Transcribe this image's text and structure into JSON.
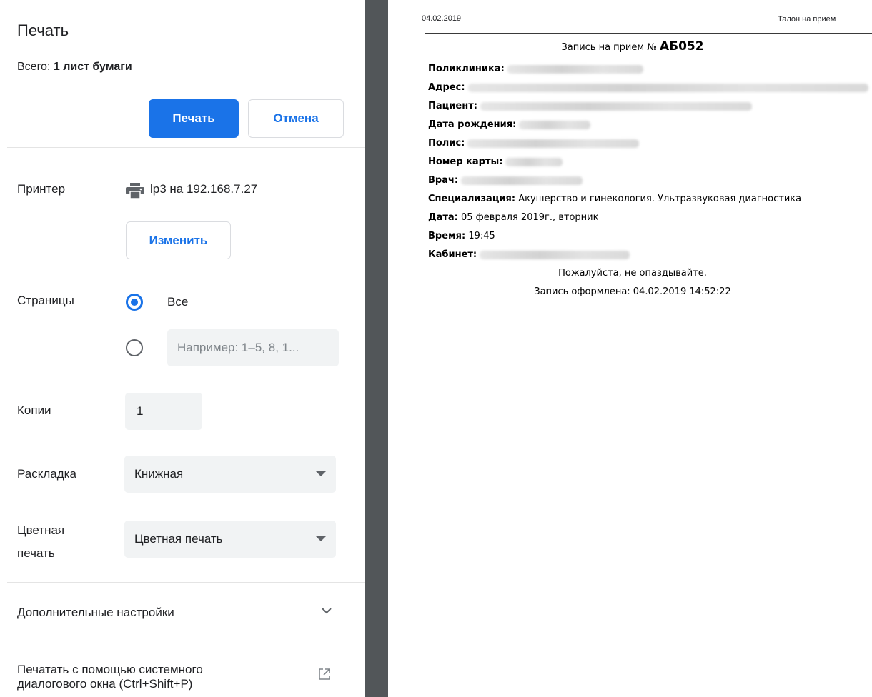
{
  "panel": {
    "title": "Печать",
    "total_prefix": "Всего: ",
    "total_value": "1 лист бумаги",
    "print_button": "Печать",
    "cancel_button": "Отмена",
    "printer_label": "Принтер",
    "printer_name": "lp3 на 192.168.7.27",
    "change_button": "Изменить",
    "pages_label": "Страницы",
    "pages_all": "Все",
    "pages_placeholder": "Например: 1–5, 8, 1...",
    "copies_label": "Копии",
    "copies_value": "1",
    "layout_label": "Раскладка",
    "layout_value": "Книжная",
    "color_label_line1": "Цветная",
    "color_label_line2": "печать",
    "color_value": "Цветная печать",
    "more_settings": "Дополнительные настройки",
    "system_dialog_line1": "Печатать с помощью системного",
    "system_dialog_line2": "диалогового окна (Ctrl+Shift+P)"
  },
  "preview": {
    "header_date": "04.02.2019",
    "header_title": "Талон на прием",
    "heading_prefix": "Запись на прием № ",
    "heading_number": "АБ052",
    "rows": {
      "clinic": "Поликлиника:",
      "address": "Адрес:",
      "patient": "Пациент:",
      "birth": "Дата рождения:",
      "policy": "Полис:",
      "card": "Номер карты:",
      "doctor": "Врач:",
      "specialization_key": "Специализация:",
      "specialization_value": " Акушерство и гинекология. Ультразвуковая диагностика",
      "date_key": "Дата:",
      "date_value": " 05 февраля 2019г., вторник",
      "time_key": "Время:",
      "time_value": " 19:45",
      "cabinet": "Кабинет:"
    },
    "footer_note": "Пожалуйста, не опаздывайте.",
    "footer_created": "Запись оформлена: 04.02.2019 14:52:22"
  },
  "icons": {
    "printer": "printer-icon",
    "chevron": "chevron-down-icon",
    "external": "open-external-icon"
  },
  "colors": {
    "accent": "#1a73e8",
    "divider": "#525659"
  }
}
